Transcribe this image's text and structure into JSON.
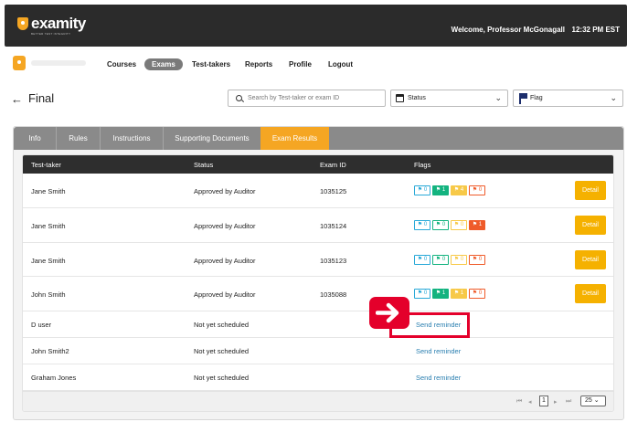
{
  "header": {
    "logo_text": "examity",
    "logo_tagline": "BETTER TEST INTEGRITY",
    "welcome": "Welcome, Professor McGonagall",
    "time": "12:32 PM  EST"
  },
  "nav": {
    "items": [
      {
        "label": "Courses"
      },
      {
        "label": "Exams",
        "active": true
      },
      {
        "label": "Test-takers"
      },
      {
        "label": "Reports"
      },
      {
        "label": "Profile"
      },
      {
        "label": "Logout"
      }
    ]
  },
  "page": {
    "title": "Final",
    "search_placeholder": "Search by Test-taker or exam ID",
    "status_select": "Status",
    "flag_select": "Flag"
  },
  "tabs": [
    {
      "label": "Info"
    },
    {
      "label": "Rules"
    },
    {
      "label": "Instructions"
    },
    {
      "label": "Supporting Documents"
    },
    {
      "label": "Exam Results",
      "active": true
    }
  ],
  "table": {
    "columns": [
      "Test-taker",
      "Status",
      "Exam ID",
      "Flags"
    ],
    "detail_label": "Detail",
    "reminder_label": "Send reminder",
    "rows": [
      {
        "name": "Jane Smith",
        "status": "Approved by Auditor",
        "exam_id": "1035125",
        "flags": [
          {
            "icon": "⚑",
            "count": "0",
            "style": "b-out-blue"
          },
          {
            "icon": "⚑",
            "count": "1",
            "style": "b-fill-green"
          },
          {
            "icon": "⚑",
            "count": "4",
            "style": "b-fill-yellow"
          },
          {
            "icon": "⚑",
            "count": "0",
            "style": "b-out-red"
          }
        ]
      },
      {
        "name": "Jane Smith",
        "status": "Approved by Auditor",
        "exam_id": "1035124",
        "flags": [
          {
            "icon": "⚑",
            "count": "0",
            "style": "b-out-blue"
          },
          {
            "icon": "⚑",
            "count": "0",
            "style": "b-out-green"
          },
          {
            "icon": "⚑",
            "count": "0",
            "style": "b-out-yellow"
          },
          {
            "icon": "⚑",
            "count": "1",
            "style": "b-fill-red"
          }
        ]
      },
      {
        "name": "Jane Smith",
        "status": "Approved by Auditor",
        "exam_id": "1035123",
        "flags": [
          {
            "icon": "⚑",
            "count": "0",
            "style": "b-out-blue"
          },
          {
            "icon": "⚑",
            "count": "0",
            "style": "b-out-green"
          },
          {
            "icon": "⚑",
            "count": "0",
            "style": "b-out-yellow"
          },
          {
            "icon": "⚑",
            "count": "0",
            "style": "b-out-red"
          }
        ]
      },
      {
        "name": "John Smith",
        "status": "Approved by Auditor",
        "exam_id": "1035088",
        "flags": [
          {
            "icon": "⚑",
            "count": "0",
            "style": "b-out-blue"
          },
          {
            "icon": "⚑",
            "count": "1",
            "style": "b-fill-green"
          },
          {
            "icon": "⚑",
            "count": "1",
            "style": "b-fill-yellow"
          },
          {
            "icon": "⚑",
            "count": "0",
            "style": "b-out-red"
          }
        ]
      },
      {
        "name": "D user",
        "status": "Not yet scheduled"
      },
      {
        "name": "John Smith2",
        "status": "Not yet scheduled"
      },
      {
        "name": "Graham Jones",
        "status": "Not yet scheduled"
      }
    ]
  },
  "pagination": {
    "current_page": "1",
    "per_page": "25"
  },
  "colors": {
    "accent": "#f5a623",
    "header_bg": "#2b2b2b",
    "annotation_red": "#e4002b",
    "link": "#2a7fb0"
  }
}
